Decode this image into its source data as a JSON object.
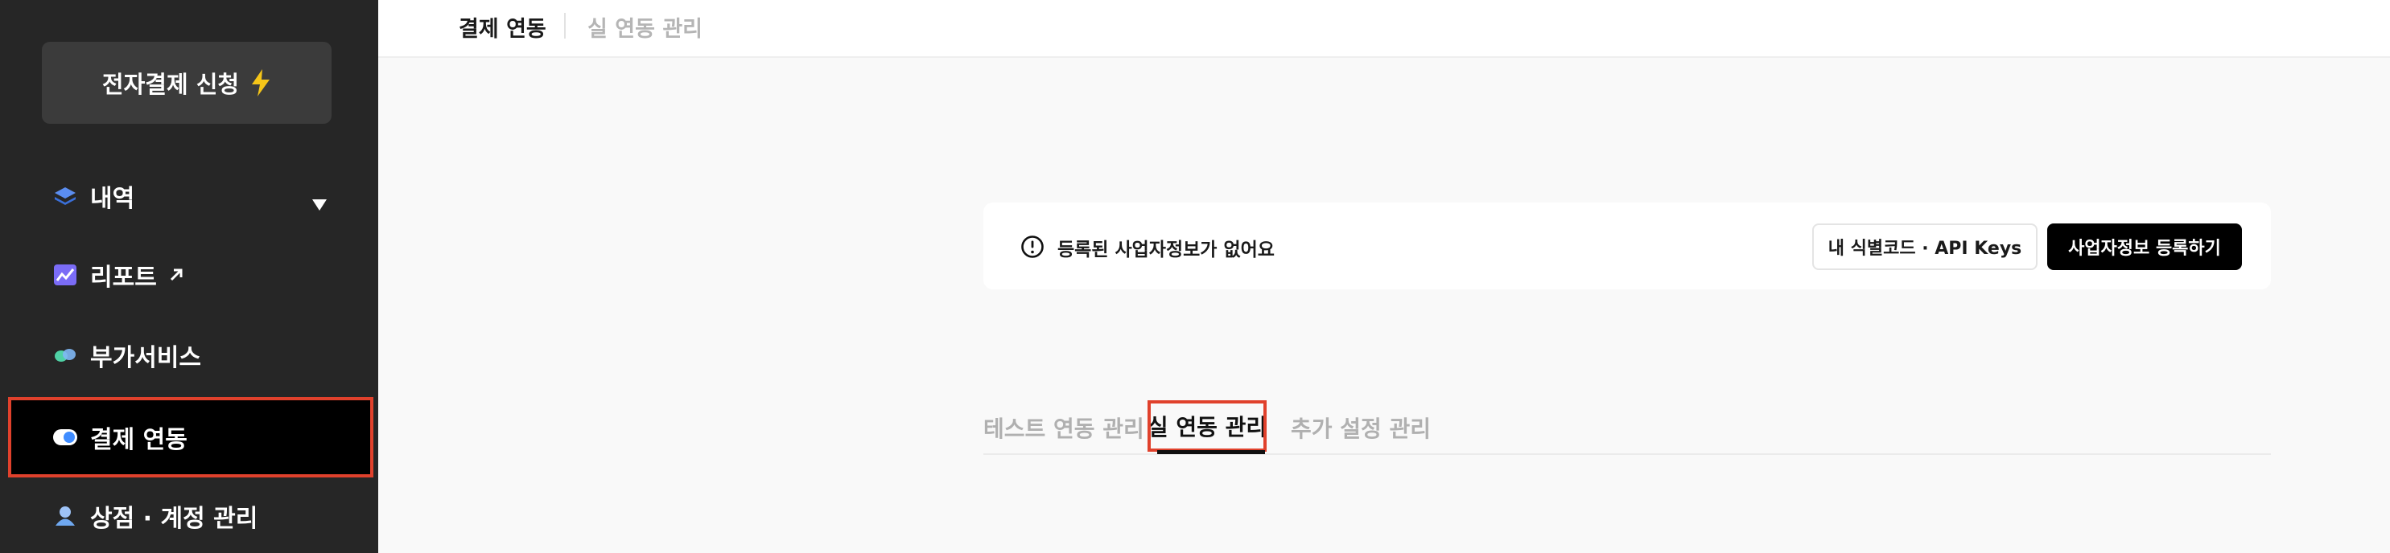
{
  "sidebar": {
    "apply_button": "전자결제 신청",
    "items": [
      {
        "label": "내역",
        "icon": "layers-icon",
        "has_dropdown": true
      },
      {
        "label": "리포트",
        "icon": "chart-icon",
        "external": true
      },
      {
        "label": "부가서비스",
        "icon": "addon-icon"
      },
      {
        "label": "결제 연동",
        "icon": "toggle-icon",
        "active": true
      },
      {
        "label": "상점 · 계정 관리",
        "icon": "store-icon"
      }
    ]
  },
  "header": {
    "tabs": [
      {
        "label": "결제 연동",
        "active": true
      },
      {
        "label": "실 연동 관리",
        "active": false
      }
    ]
  },
  "notice": {
    "message": "등록된 사업자정보가 없어요",
    "buttons": {
      "api_keys": "내 식별코드 · API Keys",
      "register": "사업자정보 등록하기"
    }
  },
  "subtabs": [
    {
      "label": "테스트 연동 관리",
      "active": false
    },
    {
      "label": "실 연동 관리",
      "active": true
    },
    {
      "label": "추가 설정 관리",
      "active": false
    }
  ],
  "colors": {
    "sidebar_bg": "#262626",
    "highlight": "#e0412c",
    "primary_button": "#000000"
  }
}
